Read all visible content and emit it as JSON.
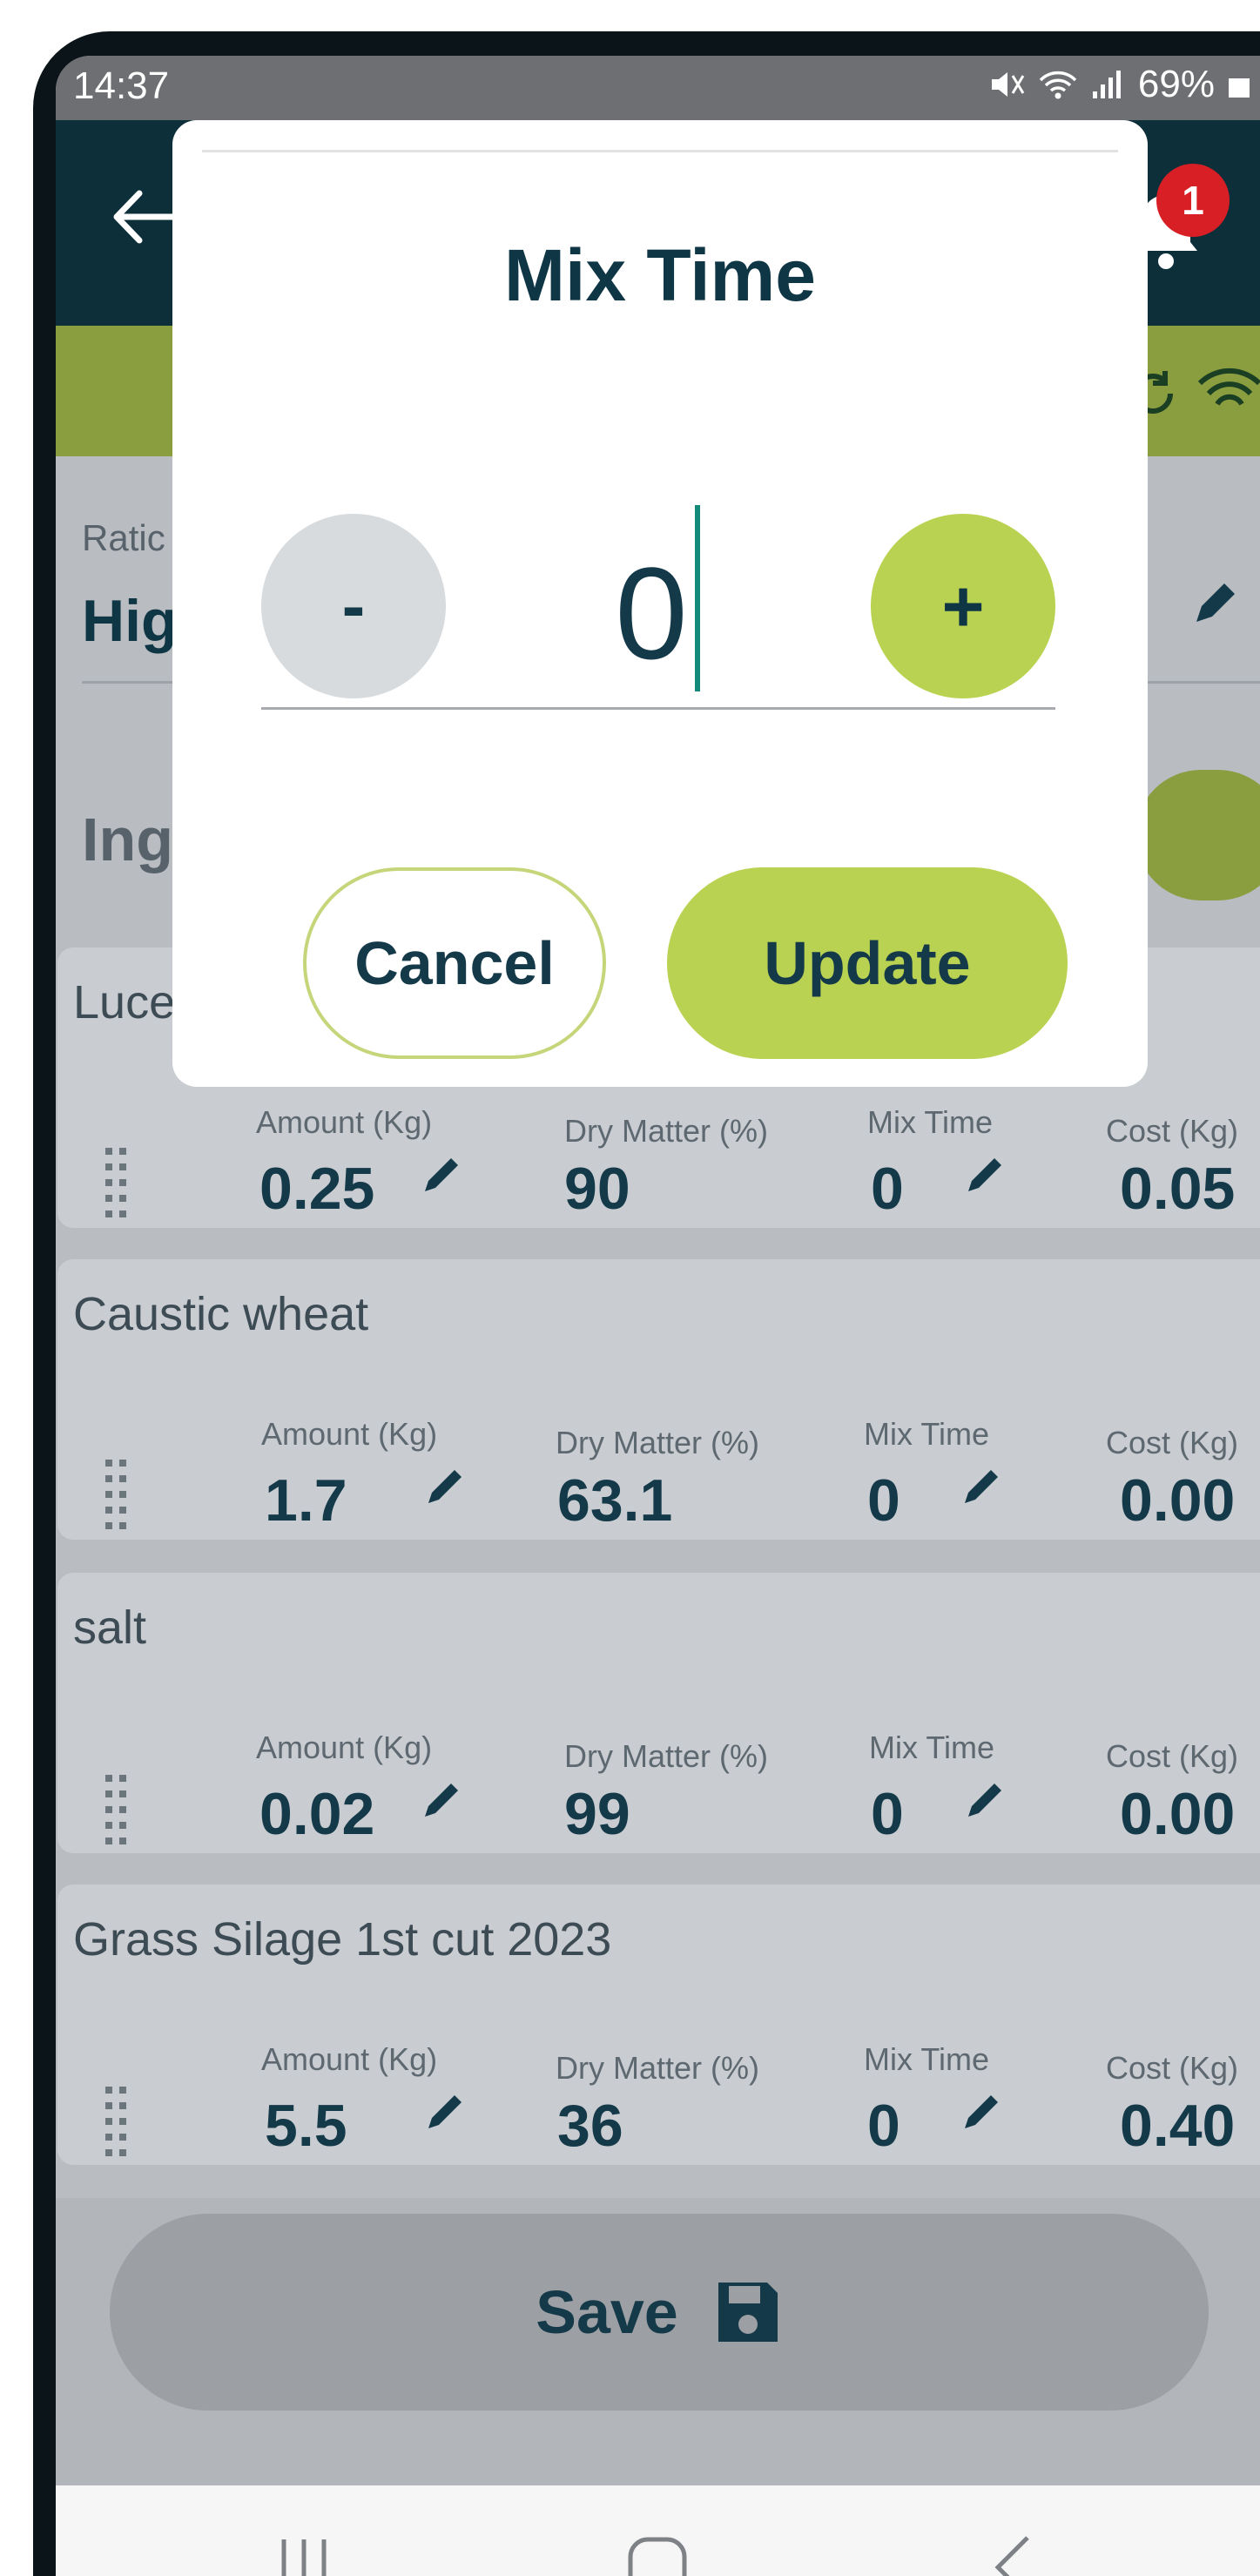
{
  "status_bar": {
    "time": "14:37",
    "battery": "69%"
  },
  "app_bar": {
    "notification_count": "1"
  },
  "ratio": {
    "label": "Ratic",
    "value": "Hig"
  },
  "ingredients": {
    "title": "Ing",
    "items": [
      {
        "name": "Luce",
        "amount_label": "Amount (Kg)",
        "amount": "0.25",
        "dry_matter_label": "Dry Matter (%)",
        "dry_matter": "90",
        "mix_time_label": "Mix Time",
        "mix_time": "0",
        "cost_label": "Cost (Kg)",
        "cost": "0.05"
      },
      {
        "name": "Caustic wheat",
        "amount_label": "Amount (Kg)",
        "amount": "1.7",
        "dry_matter_label": "Dry Matter (%)",
        "dry_matter": "63.1",
        "mix_time_label": "Mix Time",
        "mix_time": "0",
        "cost_label": "Cost (Kg)",
        "cost": "0.00"
      },
      {
        "name": "salt",
        "amount_label": "Amount (Kg)",
        "amount": "0.02",
        "dry_matter_label": "Dry Matter (%)",
        "dry_matter": "99",
        "mix_time_label": "Mix Time",
        "mix_time": "0",
        "cost_label": "Cost (Kg)",
        "cost": "0.00"
      },
      {
        "name": "Grass Silage 1st cut 2023",
        "amount_label": "Amount (Kg)",
        "amount": "5.5",
        "dry_matter_label": "Dry Matter (%)",
        "dry_matter": "36",
        "mix_time_label": "Mix Time",
        "mix_time": "0",
        "cost_label": "Cost (Kg)",
        "cost": "0.40"
      }
    ]
  },
  "save_button": {
    "label": "Save"
  },
  "dialog": {
    "title": "Mix Time",
    "minus_label": "-",
    "plus_label": "+",
    "value": "0",
    "cancel_label": "Cancel",
    "update_label": "Update"
  },
  "colors": {
    "primary_dark": "#0c2f3a",
    "accent_green": "#bad252",
    "notification_red": "#d81f26"
  },
  "icons": {
    "back": "back-arrow-icon",
    "bell": "bell-icon",
    "edit": "pencil-icon",
    "drag": "drag-handle-icon",
    "save": "floppy-disk-icon"
  }
}
